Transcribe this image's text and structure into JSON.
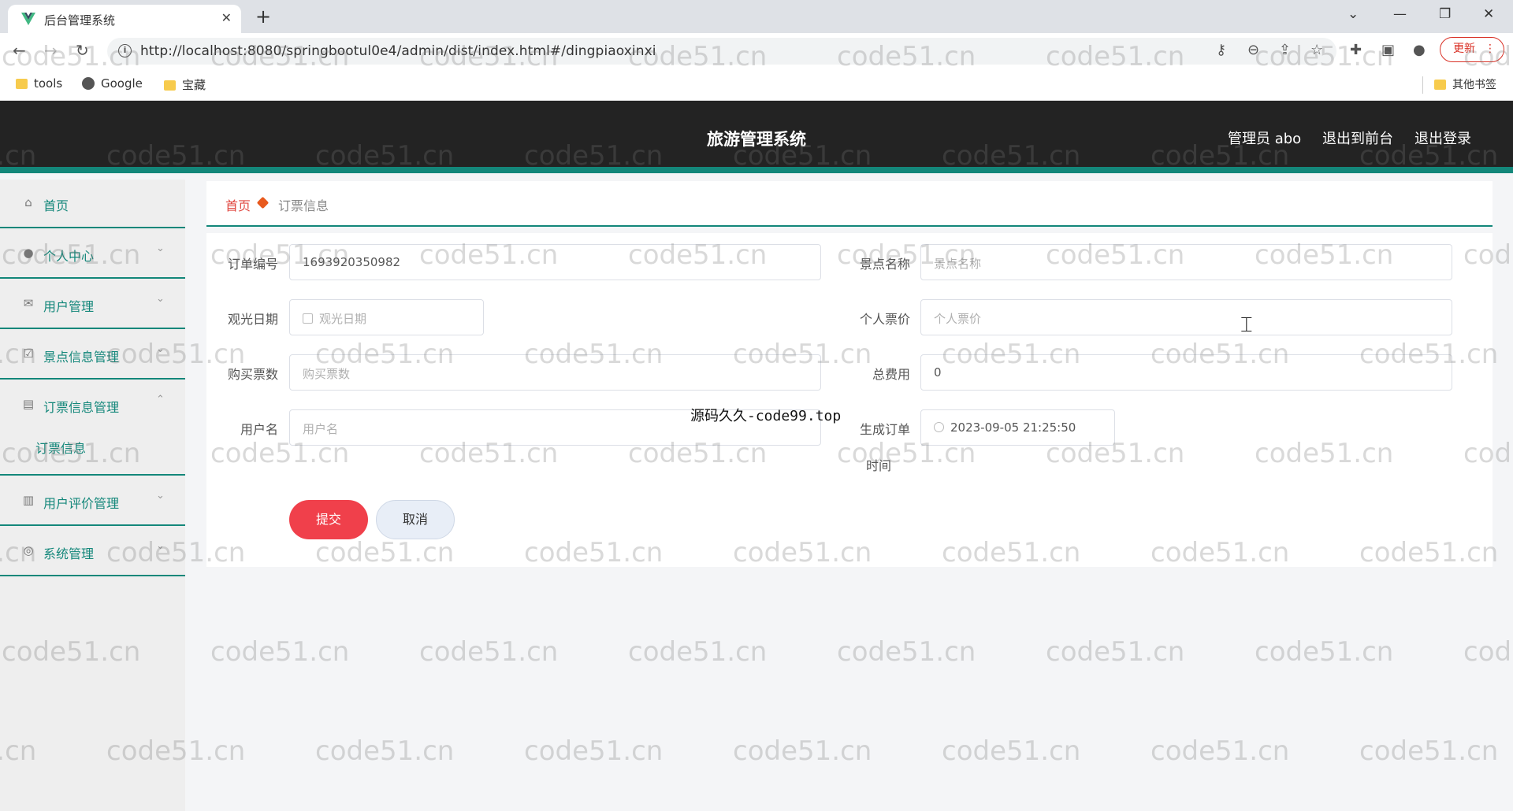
{
  "browser": {
    "tab_title": "后台管理系统",
    "url": "http://localhost:8080/springbootul0e4/admin/dist/index.html#/dingpiaoxinxi",
    "update_label": "更新",
    "bookmarks": [
      "tools",
      "Google",
      "宝藏"
    ],
    "other_bookmarks": "其他书签"
  },
  "header": {
    "title": "旅游管理系统",
    "user": "管理员 abo",
    "to_front": "退出到前台",
    "logout": "退出登录"
  },
  "sidebar": {
    "items": [
      {
        "label": "首页",
        "icon": "home-icon"
      },
      {
        "label": "个人中心",
        "icon": "user-icon"
      },
      {
        "label": "用户管理",
        "icon": "mail-icon"
      },
      {
        "label": "景点信息管理",
        "icon": "check-icon"
      },
      {
        "label": "订票信息管理",
        "icon": "clipboard-icon"
      },
      {
        "label": "用户评价管理",
        "icon": "bar-chart-icon"
      },
      {
        "label": "系统管理",
        "icon": "settings-icon"
      }
    ],
    "submenu_active": "订票信息"
  },
  "breadcrumb": {
    "home": "首页",
    "current": "订票信息"
  },
  "form": {
    "order_no": {
      "label": "订单编号",
      "value": "1693920350982"
    },
    "spot_name": {
      "label": "景点名称",
      "placeholder": "景点名称"
    },
    "visit_date": {
      "label": "观光日期",
      "placeholder": "观光日期"
    },
    "price": {
      "label": "个人票价",
      "placeholder": "个人票价"
    },
    "ticket_count": {
      "label": "购买票数",
      "placeholder": "购买票数"
    },
    "total": {
      "label": "总费用",
      "value": "0"
    },
    "username": {
      "label": "用户名",
      "placeholder": "用户名"
    },
    "created_time": {
      "label_line1": "生成订单",
      "label_line2": "时间",
      "value": "2023-09-05 21:25:50"
    },
    "submit_label": "提交",
    "cancel_label": "取消"
  },
  "overlay_text": "源码久久-code99.top",
  "watermark": "code51.cn"
}
